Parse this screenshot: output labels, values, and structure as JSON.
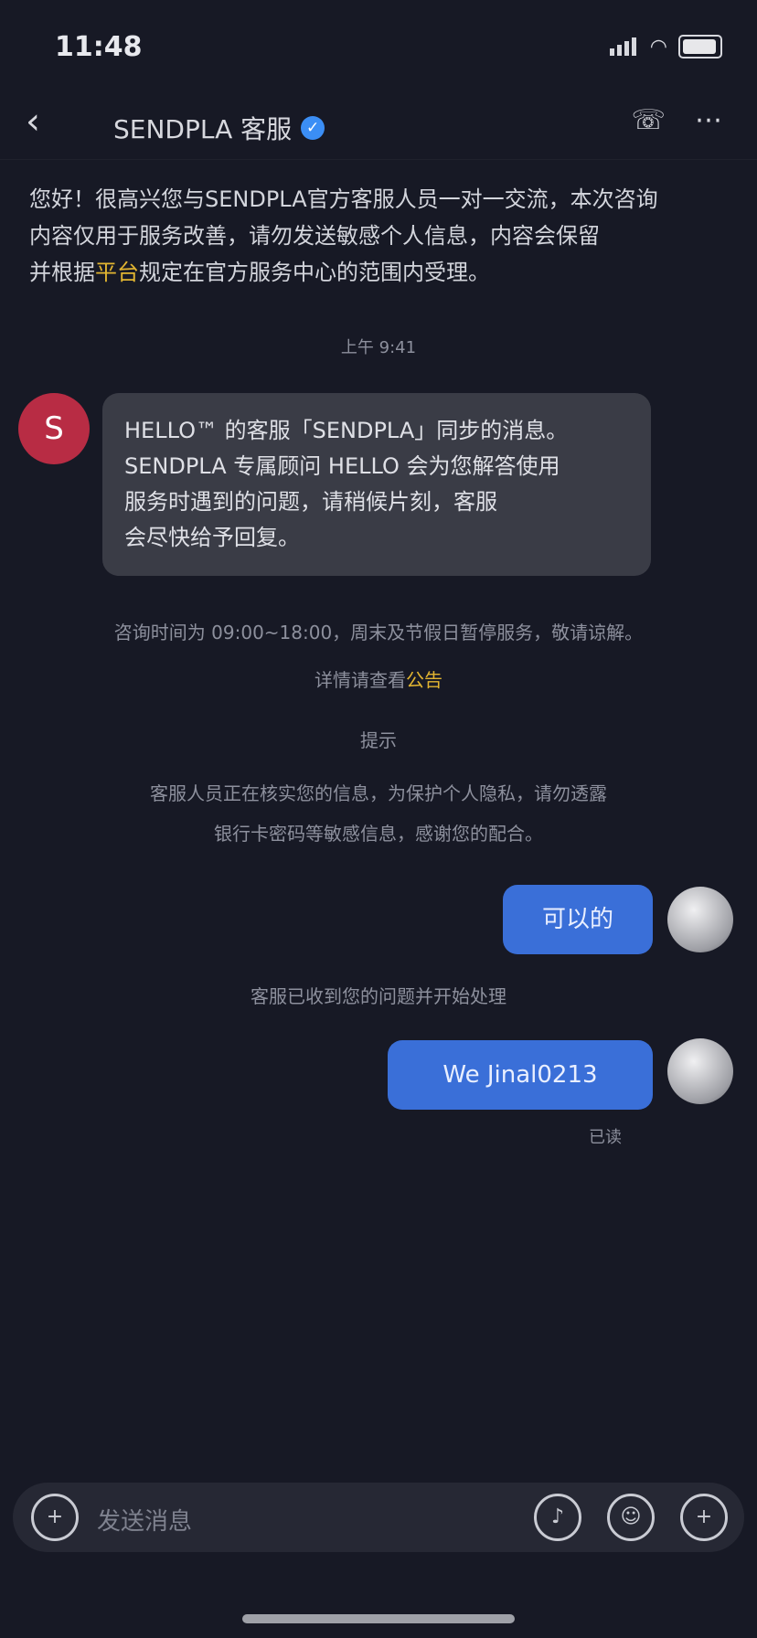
{
  "status_bar": {
    "time": "11:48"
  },
  "header": {
    "title": "SENDPLA 客服",
    "back": "‹",
    "phone_icon": "☏",
    "more_icon": "⋯"
  },
  "intro": {
    "line1": "您好！很高兴您与SENDPLA官方客服人员一对一交流，本次咨询",
    "line2": "内容仅用于服务改善，请勿发送敏感个人信息，内容会保留",
    "line3_a": "并根据",
    "line3_hl": "平台",
    "line3_b": "规定在官方服务中心的范围内受理。"
  },
  "date_sep": "上午 9:41",
  "bot_avatar_letter": "S",
  "bot_message": {
    "line1": "HELLO™ 的客服「SENDPLA」同步的消息。",
    "line2": "SENDPLA 专属顾问 HELLO 会为您解答使用",
    "line3": "服务时遇到的问题，请稍候片刻，客服",
    "line4": "会尽快给予回复。"
  },
  "notices": {
    "line1": "咨询时间为 09:00~18:00，周末及节假日暂停服务，敬请谅解。",
    "line2_a": "详情请查看",
    "line2_hl": "公告",
    "label": "提示",
    "line3": "客服人员正在核实您的信息，为保护个人隐私，请勿透露",
    "line4": "银行卡密码等敏感信息，感谢您的配合。"
  },
  "user_msg_1": "可以的",
  "system_note": "客服已收到您的问题并开始处理",
  "user_msg_2": "We Jinal0213",
  "read_label": "已读",
  "input": {
    "placeholder": "发送消息"
  },
  "colors": {
    "background": "#171925",
    "accent_blue": "#3a6fd8",
    "highlight": "#e2b531",
    "bot_red": "#b82c44"
  }
}
